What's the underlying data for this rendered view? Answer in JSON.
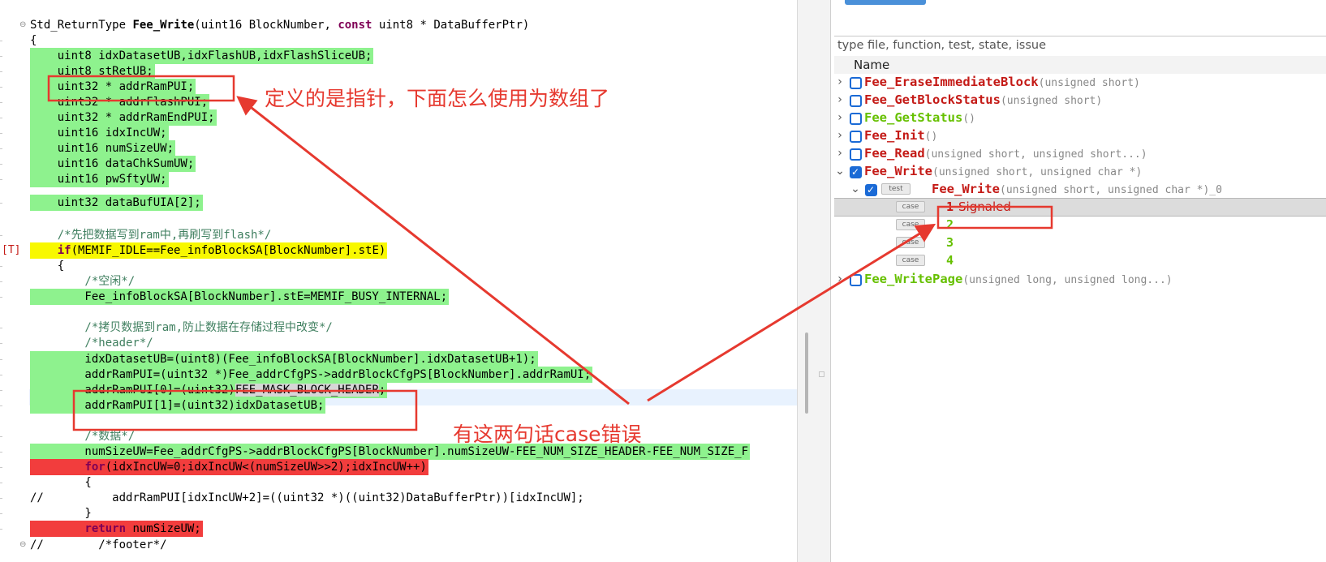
{
  "editor": {
    "signature": {
      "prefix": "Std_ReturnType ",
      "name": "Fee_Write",
      "params_a": "(uint16 BlockNumber, ",
      "kw_const": "const",
      "params_b": " uint8 * DataBufferPtr)"
    },
    "open_brace": "{",
    "decls": [
      "    uint8 idxDatasetUB,idxFlashUB,idxFlashSliceUB;",
      "    uint8 stRetUB;",
      "    uint32 * addrRamPUI;",
      "    uint32 * addrFlashPUI;",
      "    uint32 * addrRamEndPUI;",
      "    uint16 idxIncUW;",
      "    uint16 numSizeUW;",
      "    uint16 dataChkSumUW;",
      "    uint16 pwSftyUW;",
      "    uint32 dataBufUIA[2];"
    ],
    "comment_write": "    /*先把数据写到ram中,再刷写到flash*/",
    "if_marker": "[T]",
    "if_kw": "if",
    "if_rest": "(MEMIF_IDLE==Fee_infoBlockSA[BlockNumber].stE)",
    "inner_open": "    {",
    "comment_idle": "        /*空闲*/",
    "busy_stmt": "        Fee_infoBlockSA[BlockNumber].stE=MEMIF_BUSY_INTERNAL;",
    "comment_copy": "        /*拷贝数据到ram,防止数据在存储过程中改变*/",
    "comment_header": "        /*header*/",
    "stmt_idx": "        idxDatasetUB=(uint8)(Fee_infoBlockSA[BlockNumber].idxDatasetUB+1);",
    "stmt_addr": "        addrRamPUI=(uint32 *)Fee_addrCfgPS->addrBlockCfgPS[BlockNumber].addrRamUI;",
    "stmt_arr0_a": "        addrRamPUI[0]=(uint32)",
    "stmt_arr0_sel": "FEE_MASK_BLOCK_HEADER",
    "stmt_arr0_b": ";",
    "stmt_arr1": "        addrRamPUI[1]=(uint32)idxDatasetUB;",
    "comment_data": "        /*数据*/",
    "stmt_numsize": "        numSizeUW=Fee_addrCfgPS->addrBlockCfgPS[BlockNumber].numSizeUW-FEE_NUM_SIZE_HEADER-FEE_NUM_SIZE_F",
    "for_indent": "        ",
    "for_kw": "for",
    "for_rest": "(idxIncUW=0;idxIncUW<(numSizeUW>>2);idxIncUW++)",
    "for_open": "        {",
    "commented_line": "//          addrRamPUI[idxIncUW+2]=((uint32 *)((uint32)DataBufferPtr))[idxIncUW];",
    "for_close": "        }",
    "ret_indent": "        ",
    "ret_kw": "return",
    "ret_rest": " numSizeUW;",
    "footer_partial": "//        /*footer*/"
  },
  "panel": {
    "filter_placeholder": "type file, function, test, state, issue",
    "column_name": "Name",
    "items": [
      {
        "name": "Fee_EraseImmediateBlock",
        "args": "(unsigned short)"
      },
      {
        "name": "Fee_GetBlockStatus",
        "args": "(unsigned short)"
      },
      {
        "name": "Fee_GetStatus",
        "args": "()"
      },
      {
        "name": "Fee_Init",
        "args": "()"
      },
      {
        "name": "Fee_Read",
        "args": "(unsigned short, unsigned short...)"
      },
      {
        "name": "Fee_Write",
        "args": "(unsigned short, unsigned char *)"
      },
      {
        "name": "Fee_WritePage",
        "args": "(unsigned long, unsigned long...)"
      }
    ],
    "test_badge": "test",
    "test_name": "Fee_Write",
    "test_args": "(unsigned short, unsigned char *)_0",
    "case_badge": "case",
    "cases": [
      {
        "num": "1",
        "status": "Signaled"
      },
      {
        "num": "2",
        "status": ""
      },
      {
        "num": "3",
        "status": ""
      },
      {
        "num": "4",
        "status": ""
      }
    ]
  },
  "annotations": {
    "pointer_note": "定义的是指针，下面怎么使用为数组了",
    "case_error_note": "有这两句话case错误"
  },
  "colors": {
    "covered": "#8ef28e",
    "partial": "#f8f800",
    "uncovered": "#f23d3d",
    "annotation": "#e6392f",
    "failed_text": "#c41a16",
    "passed_text": "#66c000"
  }
}
